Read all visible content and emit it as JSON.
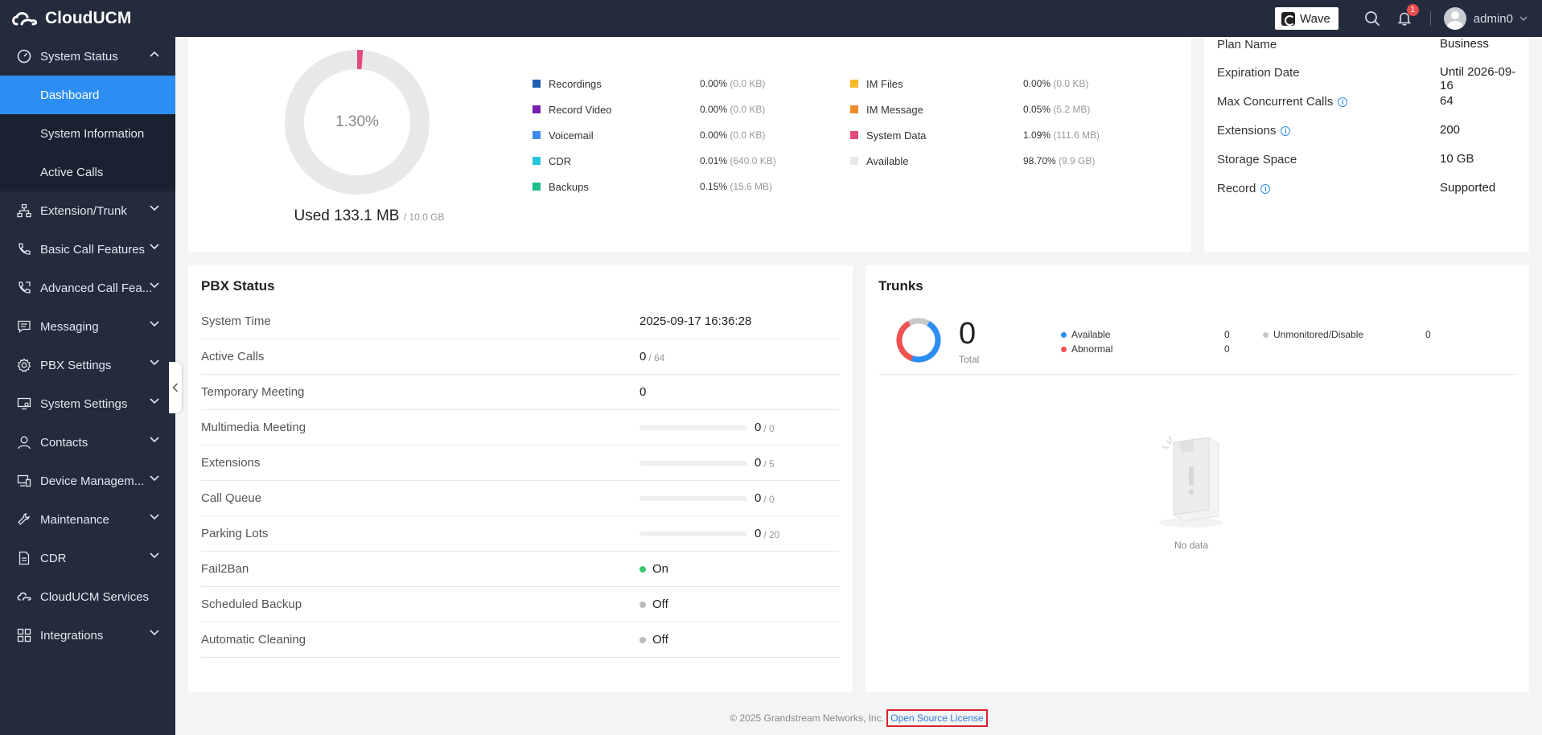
{
  "app": {
    "title": "CloudUCM"
  },
  "topbar": {
    "wave_label": "Wave",
    "notification_count": "1",
    "username": "admin0"
  },
  "sidebar": {
    "system_status": "System Status",
    "sub": [
      "Dashboard",
      "System Information",
      "Active Calls"
    ],
    "items": [
      "Extension/Trunk",
      "Basic Call Features",
      "Advanced Call Fea...",
      "Messaging",
      "PBX Settings",
      "System Settings",
      "Contacts",
      "Device Managem...",
      "Maintenance",
      "CDR",
      "CloudUCM Services",
      "Integrations"
    ]
  },
  "storage": {
    "percent_label": "1.30%",
    "used_label": "Used 133.1 MB",
    "total_label": "/ 10.0 GB",
    "used_fraction": 0.013,
    "legend_left": [
      {
        "name": "Recordings",
        "pct": "0.00%",
        "size": "(0.0 KB)",
        "color": "#1f5fb0"
      },
      {
        "name": "Record Video",
        "pct": "0.00%",
        "size": "(0.0 KB)",
        "color": "#7b1fb0"
      },
      {
        "name": "Voicemail",
        "pct": "0.00%",
        "size": "(0.0 KB)",
        "color": "#3d8be8"
      },
      {
        "name": "CDR",
        "pct": "0.01%",
        "size": "(640.0 KB)",
        "color": "#26c6da"
      },
      {
        "name": "Backups",
        "pct": "0.15%",
        "size": "(15.6 MB)",
        "color": "#1dbf8a"
      }
    ],
    "legend_right": [
      {
        "name": "IM Files",
        "pct": "0.00%",
        "size": "(0.0 KB)",
        "color": "#f6b928"
      },
      {
        "name": "IM Message",
        "pct": "0.05%",
        "size": "(5.2 MB)",
        "color": "#f28a2e"
      },
      {
        "name": "System Data",
        "pct": "1.09%",
        "size": "(111.6 MB)",
        "color": "#e24a78"
      },
      {
        "name": "Available",
        "pct": "98.70%",
        "size": "(9.9 GB)",
        "color": "#e8e8e8"
      }
    ]
  },
  "plan": {
    "rows": [
      {
        "key": "Plan Name",
        "value": "Business",
        "info": false
      },
      {
        "key": "Expiration Date",
        "value": "Until 2026-09-16",
        "info": false
      },
      {
        "key": "Max Concurrent Calls",
        "value": "64",
        "info": true
      },
      {
        "key": "Extensions",
        "value": "200",
        "info": true
      },
      {
        "key": "Storage Space",
        "value": "10 GB",
        "info": false
      },
      {
        "key": "Record",
        "value": "Supported",
        "info": true
      }
    ]
  },
  "pbx": {
    "title": "PBX Status",
    "rows": [
      {
        "key": "System Time",
        "value": "2025-09-17 16:36:28",
        "sub": ""
      },
      {
        "key": "Active Calls",
        "value": "0",
        "sub": "/ 64"
      },
      {
        "key": "Temporary Meeting",
        "value": "0",
        "sub": ""
      },
      {
        "key": "Multimedia Meeting",
        "value": "0",
        "sub": "/ 0",
        "progress": 0
      },
      {
        "key": "Extensions",
        "value": "0",
        "sub": "/ 5",
        "progress": 0
      },
      {
        "key": "Call Queue",
        "value": "0",
        "sub": "/ 0",
        "progress": 0
      },
      {
        "key": "Parking Lots",
        "value": "0",
        "sub": "/ 20",
        "progress": 0
      },
      {
        "key": "Fail2Ban",
        "value": "On",
        "status_color": "#3cc86e"
      },
      {
        "key": "Scheduled Backup",
        "value": "Off",
        "status_color": "#bbbbbb"
      },
      {
        "key": "Automatic Cleaning",
        "value": "Off",
        "status_color": "#bbbbbb"
      }
    ]
  },
  "trunks": {
    "title": "Trunks",
    "total": "0",
    "total_label": "Total",
    "available_label": "Available",
    "available_count": "0",
    "abnormal_label": "Abnormal",
    "abnormal_count": "0",
    "unmonitored_label": "Unmonitored/Disable",
    "unmonitored_count": "0",
    "no_data": "No data"
  },
  "footer": {
    "copyright": "© 2025 Grandstream Networks, Inc.",
    "license_link": "Open Source License"
  },
  "colors": {
    "accent": "#2c8ef2",
    "sidebar_bg": "#232b3c",
    "used_arc": "#e24a78"
  }
}
